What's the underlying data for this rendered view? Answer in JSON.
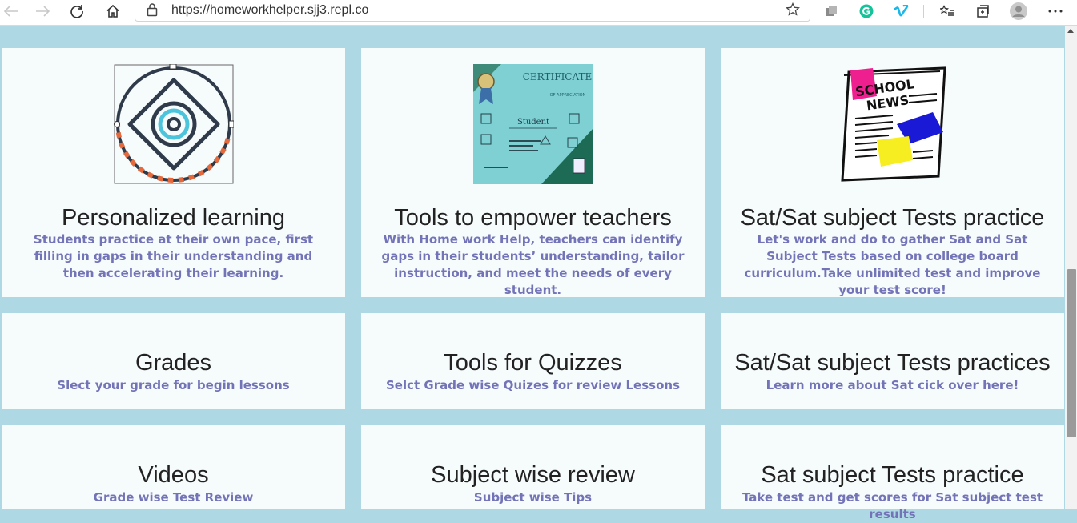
{
  "browser": {
    "url": "https://homeworkhelper.sjj3.repl.co",
    "icons": [
      "back-icon",
      "forward-icon",
      "refresh-icon",
      "home-icon",
      "lock-icon",
      "favorite-star-icon",
      "collections-icon",
      "grammarly-icon",
      "vimeo-icon",
      "favorites-icon",
      "tab-icon",
      "profile-icon",
      "more-icon"
    ]
  },
  "colors": {
    "page_bg": "#add8e4",
    "card_bg": "#f6fbfc",
    "title": "#222222",
    "desc": "#7373b8"
  },
  "cards": [
    {
      "title": "Personalized learning",
      "desc": "Students practice at their own pace, first filling in gaps in their understanding and then accelerating their learning.",
      "image": "eye-vector-icon"
    },
    {
      "title": "Tools to empower teachers",
      "desc": "With Home work Help, teachers can identify gaps in their students’ understanding, tailor instruction, and meet the needs of every student.",
      "image": "certificate-image",
      "image_text": {
        "heading": "CERTIFICATE",
        "sub": "OF APPRECIATION",
        "name": "Student"
      }
    },
    {
      "title": "Sat/Sat subject Tests practice",
      "desc": "Let's work and do to gather Sat and Sat Subject Tests based on college board curriculum.Take unlimited test and improve your test score!",
      "image": "school-news-image",
      "image_text": {
        "line1": "SCHOOL",
        "line2": "NEWS"
      }
    },
    {
      "title": "Grades",
      "desc": "Slect your grade for begin lessons"
    },
    {
      "title": "Tools for Quizzes",
      "desc": "Selct Grade wise Quizes for review Lessons"
    },
    {
      "title": "Sat/Sat subject Tests practices",
      "desc": "Learn more about Sat cick over here!"
    },
    {
      "title": "Videos",
      "desc": "Grade wise Test Review"
    },
    {
      "title": "Subject wise review",
      "desc": "Subject wise Tips"
    },
    {
      "title": "Sat subject Tests practice",
      "desc": "Take test and get scores for Sat subject test results"
    }
  ]
}
